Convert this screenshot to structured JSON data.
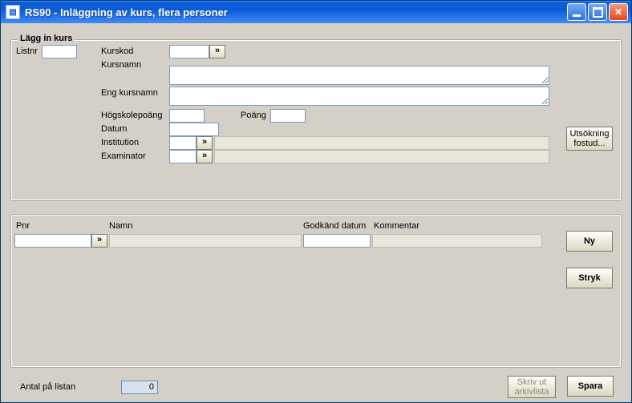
{
  "window": {
    "title": "RS90 - Inläggning av kurs, flera personer"
  },
  "group1": {
    "legend": "Lägg in kurs",
    "listnr_label": "Listnr",
    "kurskod_label": "Kurskod",
    "kursnamn_label": "Kursnamn",
    "engkursnamn_label": "Eng kursnamn",
    "hogskolepoang_label": "Högskolepoäng",
    "poang_label": "Poäng",
    "datum_label": "Datum",
    "institution_label": "Institution",
    "examinator_label": "Examinator",
    "pick_glyph": "»",
    "values": {
      "listnr": "",
      "kurskod": "",
      "kursnamn": "",
      "engkursnamn": "",
      "hogskolepoang": "",
      "poang": "",
      "datum": "",
      "institution_code": "",
      "institution_name": "",
      "examinator_code": "",
      "examinator_name": ""
    },
    "utsokning_button": "Utsökning fostud..."
  },
  "panel2": {
    "pnr_label": "Pnr",
    "namn_label": "Namn",
    "godkdatum_label": "Godkänd datum",
    "kommentar_label": "Kommentar",
    "pick_glyph": "»",
    "values": {
      "pnr": "",
      "namn": "",
      "godkand_datum": "",
      "kommentar": ""
    }
  },
  "side_buttons": {
    "ny": "Ny",
    "stryk": "Stryk"
  },
  "footer": {
    "antal_label": "Antal på listan",
    "antal_value": "0",
    "skriv_ut": "Skriv ut arkivlista",
    "spara": "Spara"
  }
}
